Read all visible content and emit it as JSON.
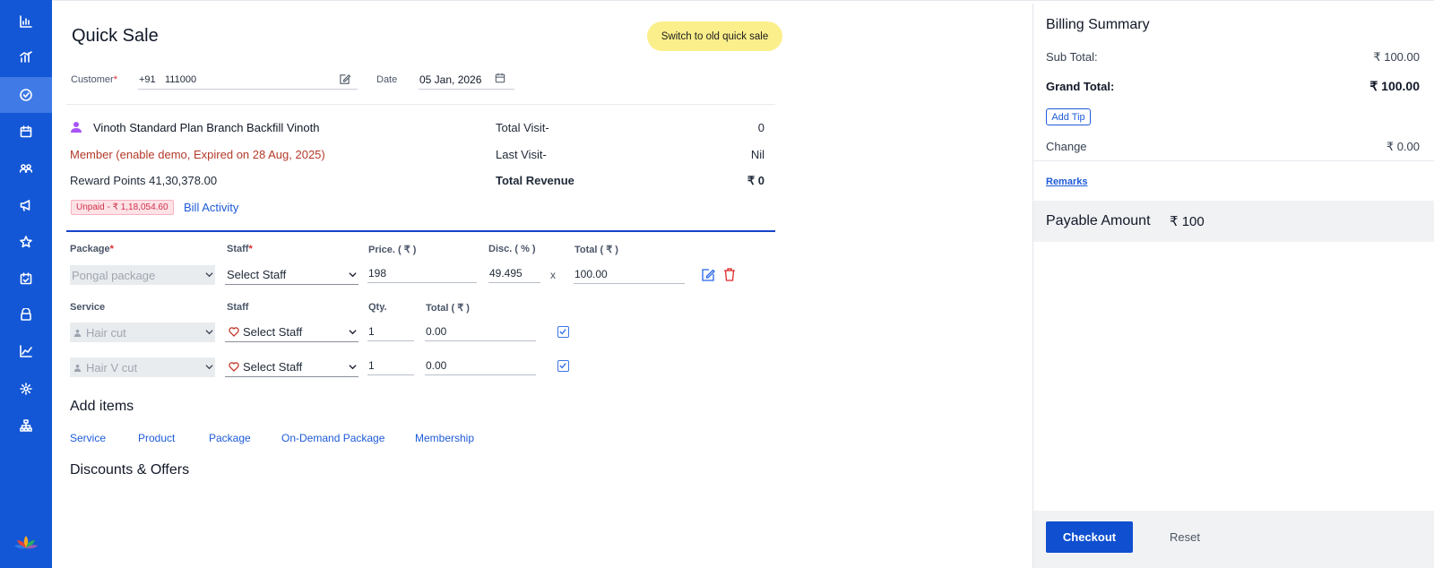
{
  "sidebar": {
    "icons": [
      "dashboard-icon",
      "analytics-icon",
      "quick-sale-icon",
      "calendar-icon",
      "customers-icon",
      "campaign-icon",
      "star-icon",
      "appointments-icon",
      "lock-icon",
      "reports-icon",
      "settings-icon",
      "organization-icon"
    ],
    "active_index": 2
  },
  "main": {
    "title": "Quick Sale",
    "switch_label": "Switch to old quick sale",
    "customer_label": "Customer",
    "required_mark": "*",
    "phone_prefix": "+91",
    "phone_value": "111000",
    "date_label": "Date",
    "date_value": "05 Jan, 2026"
  },
  "customer": {
    "name": "Vinoth Standard Plan Branch Backfill Vinoth",
    "membership": "Member (enable demo, Expired on 28 Aug, 2025)",
    "reward_points": "Reward Points 41,30,378.00",
    "unpaid_badge": "Unpaid - ₹ 1,18,054.60",
    "bill_activity": "Bill Activity",
    "stats": [
      {
        "label": "Total Visit-",
        "value": "0"
      },
      {
        "label": "Last Visit-",
        "value": "Nil"
      },
      {
        "label": "Total Revenue",
        "value": "₹ 0"
      }
    ]
  },
  "package_table": {
    "headers": {
      "package": "Package",
      "staff": "Staff",
      "price": "Price. ( ₹ )",
      "disc": "Disc. ( % )",
      "total": "Total ( ₹ )"
    },
    "row": {
      "package": "Pongal package",
      "staff": "Select Staff",
      "price": "198",
      "disc": "49.495",
      "x": "x",
      "total": "100.00"
    }
  },
  "service_table": {
    "headers": {
      "service": "Service",
      "staff": "Staff",
      "qty": "Qty.",
      "total": "Total ( ₹ )"
    },
    "rows": [
      {
        "service": "Hair cut",
        "staff": "Select Staff",
        "qty": "1",
        "total": "0.00"
      },
      {
        "service": "Hair V cut",
        "staff": "Select Staff",
        "qty": "1",
        "total": "0.00"
      }
    ]
  },
  "add_items": {
    "title": "Add items",
    "links": [
      "Service",
      "Product",
      "Package",
      "On-Demand Package",
      "Membership"
    ]
  },
  "discounts_title": "Discounts & Offers",
  "billing": {
    "title": "Billing Summary",
    "sub_total_label": "Sub Total:",
    "sub_total_value": "₹ 100.00",
    "grand_total_label": "Grand Total:",
    "grand_total_value": "₹ 100.00",
    "add_tip": "Add Tip",
    "change_label": "Change",
    "change_value": "₹ 0.00",
    "remarks": "Remarks",
    "payable_label": "Payable Amount",
    "payable_value": "₹ 100",
    "checkout": "Checkout",
    "reset": "Reset"
  },
  "colors": {
    "sidebar": "#1457d6",
    "accent": "#1e5bd8",
    "switch_bg": "#fbef8c",
    "checkout_bg": "#0f4fd0",
    "member_text": "#b33a2a"
  }
}
